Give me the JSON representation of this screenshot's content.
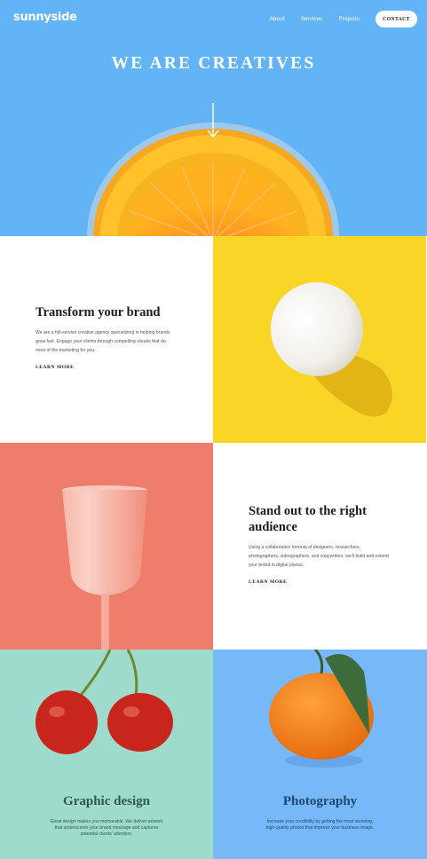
{
  "header": {
    "logo": "sunnyside",
    "nav": [
      "About",
      "Services",
      "Projects"
    ],
    "contact_label": "CONTACT"
  },
  "hero": {
    "title": "WE ARE CREATIVES"
  },
  "transform": {
    "title": "Transform your brand",
    "text": "We are a full-service creative agency specializing in helping brands grow fast. Engage your clients through compelling visuals that do most of the marketing for you.",
    "link": "LEARN MORE"
  },
  "standout": {
    "title": "Stand out to the right audience",
    "text": "Using a collaborative formula of designers, researchers, photographers, videographers, and copywriters, we'll build and extend your brand in digital places.",
    "link": "LEARN MORE"
  },
  "graphic": {
    "title": "Graphic design",
    "text": "Great design makes you memorable. We deliver artwork that underscores your brand message and captures potential clients' attention."
  },
  "photography": {
    "title": "Photography",
    "text": "Increase your credibility by getting the most stunning, high-quality photos that improve your business image."
  },
  "colors": {
    "hero_bg": "#62b4f6",
    "yellow": "#f8d526",
    "pink": "#ef7d6b",
    "mint": "#9fdbcd",
    "blue": "#77b9f8"
  },
  "icons": [
    "arrow-down-icon"
  ]
}
